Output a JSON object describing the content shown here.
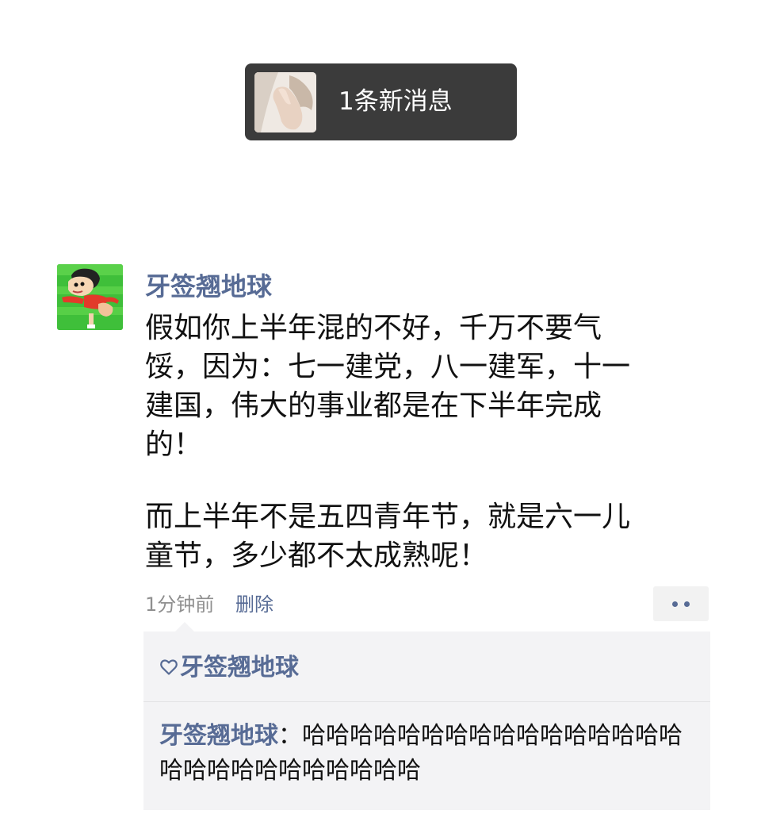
{
  "new_message": {
    "label": "1条新消息"
  },
  "post": {
    "author": "牙签翘地球",
    "lines": [
      "假如你上半年混的不好，千万不要气",
      "馁，因为：七一建党，八一建军，十一",
      "建国，伟大的事业都是在下半年完成",
      "的！",
      "而上半年不是五四青年节，就是六一儿",
      "童节，多少都不太成熟呢！"
    ],
    "time": "1分钟前",
    "delete_label": "删除"
  },
  "likes": {
    "names": "牙签翘地球"
  },
  "comments": [
    {
      "author": "牙签翘地球",
      "separator": "：",
      "text": "哈哈哈哈哈哈哈哈哈哈哈哈哈哈哈哈哈哈哈哈哈哈哈哈哈哈哈"
    }
  ],
  "colors": {
    "link": "#576b95",
    "pill_background": "#3b3b3b",
    "interaction_background": "#f3f3f5"
  }
}
